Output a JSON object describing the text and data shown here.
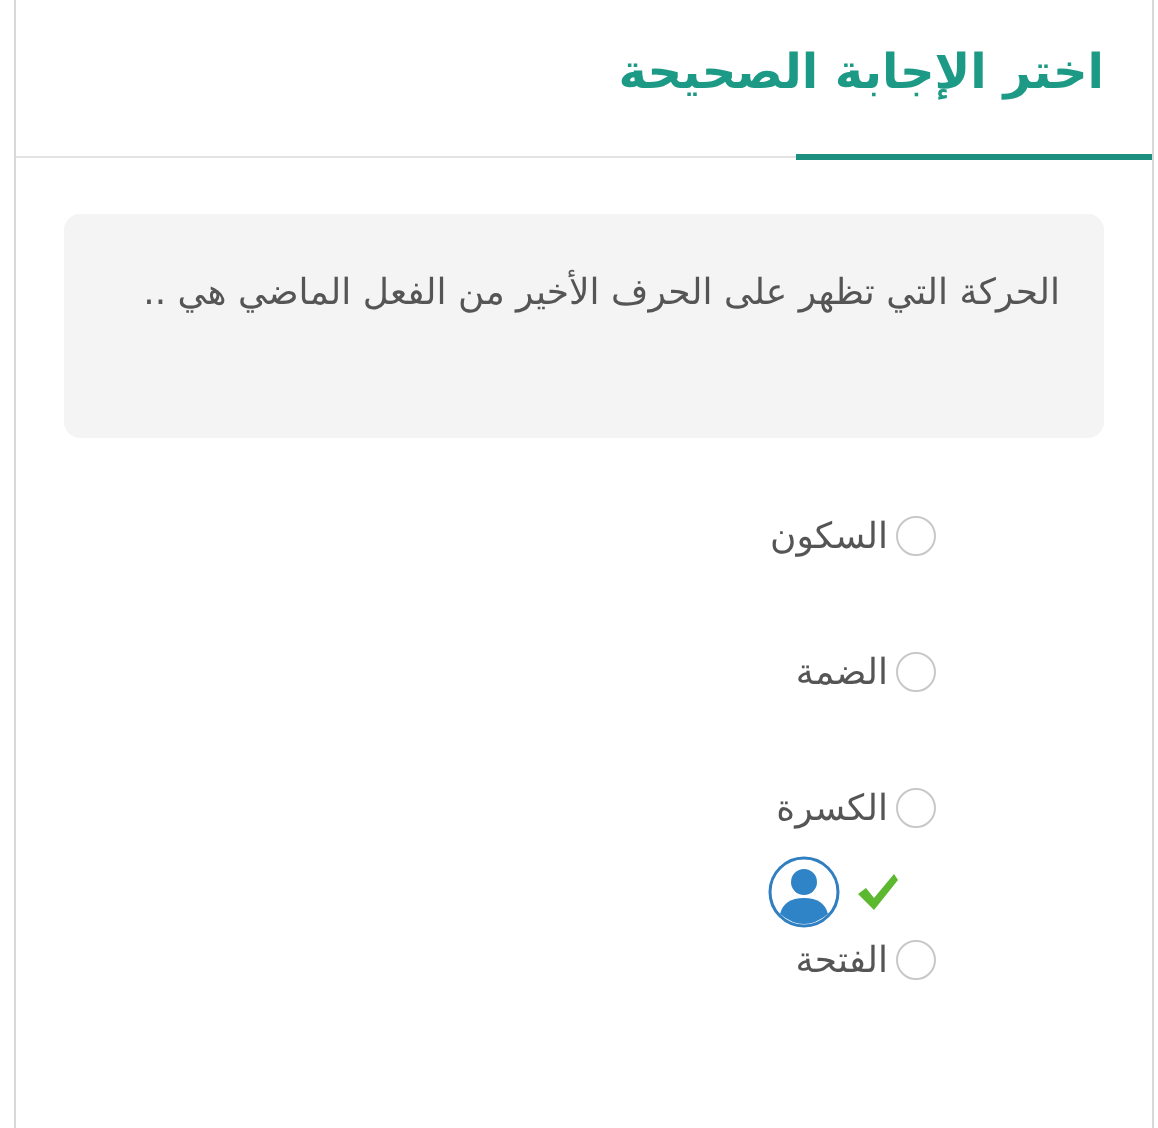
{
  "title": "اختر الإجابة الصحيحة",
  "question": "الحركة التي تظهر على الحرف الأخير من الفعل الماضي هي ..",
  "options": [
    {
      "label": "السكون",
      "selected": false,
      "correct": false
    },
    {
      "label": "الضمة",
      "selected": false,
      "correct": false
    },
    {
      "label": "الكسرة",
      "selected": false,
      "correct": false
    },
    {
      "label": "الفتحة",
      "selected": false,
      "correct": true
    }
  ]
}
